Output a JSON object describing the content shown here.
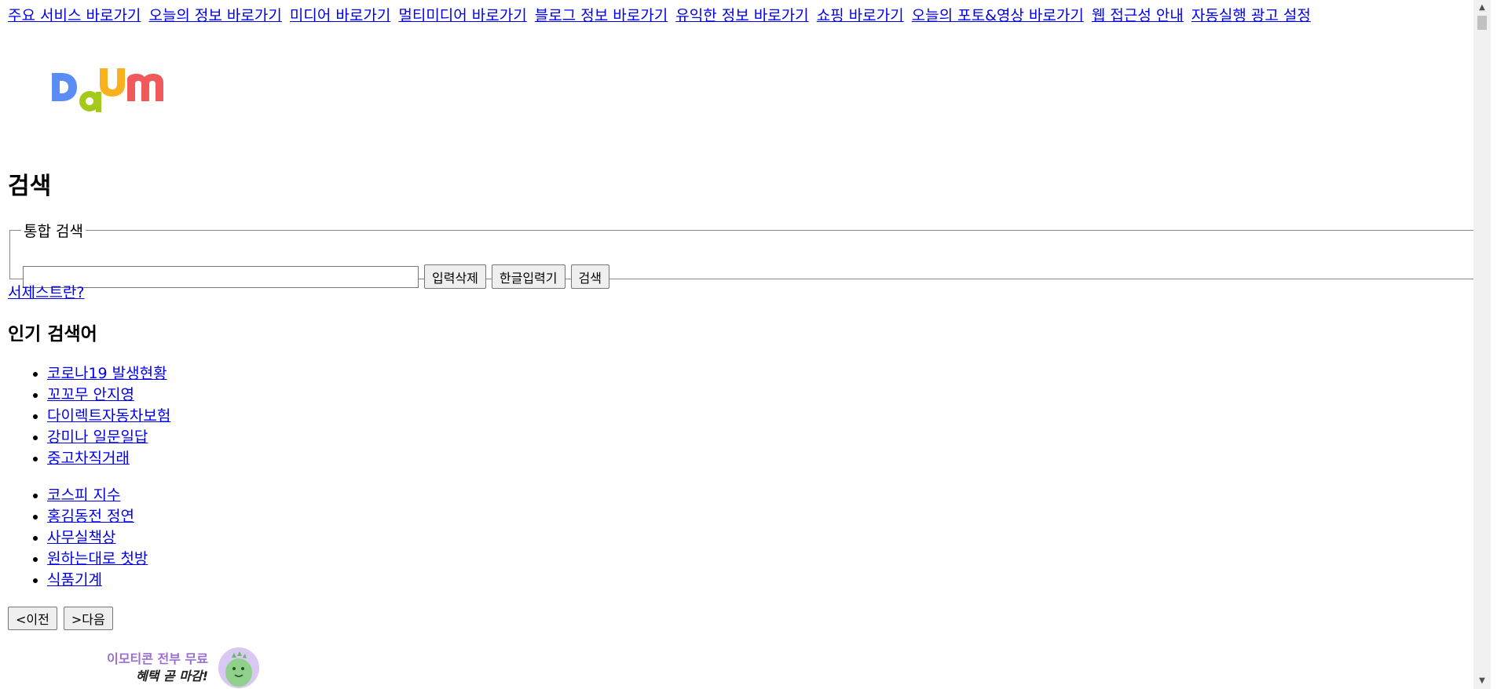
{
  "skip_nav": [
    "주요 서비스 바로가기",
    "오늘의 정보 바로가기",
    "미디어 바로가기",
    "멀티미디어 바로가기",
    "블로그 정보 바로가기",
    "유익한 정보 바로가기",
    "쇼핑 바로가기",
    "오늘의 포토&영상 바로가기",
    "웹 접근성 안내",
    "자동실행 광고 설정"
  ],
  "logo": {
    "icon": "daum-logo",
    "text": "Daum",
    "colors": [
      "#5b8cf5",
      "#a4c91a",
      "#f9b21e",
      "#f15a5a"
    ]
  },
  "search": {
    "heading": "검색",
    "legend": "통합 검색",
    "input_value": "",
    "clear_label": "입력삭제",
    "hangul_keyboard_label": "한글입력기",
    "submit_label": "검색",
    "suggest_link": "서제스트란?"
  },
  "popular": {
    "heading": "인기 검색어",
    "group1": [
      "코로나19 발생현황",
      "꼬꼬무 안지영",
      "다이렉트자동차보험",
      "강미나 일문일답",
      "중고차직거래"
    ],
    "group2": [
      "코스피 지수",
      "홍김동전 정연",
      "사무실책상",
      "원하는대로 첫방",
      "식품기계"
    ],
    "prev_label": "<이전",
    "next_label": ">다음"
  },
  "banner": {
    "line1": "이모티콘 전부 무료",
    "line2": "혜택 곧 마감!",
    "icon": "dinosaur-character-icon"
  }
}
